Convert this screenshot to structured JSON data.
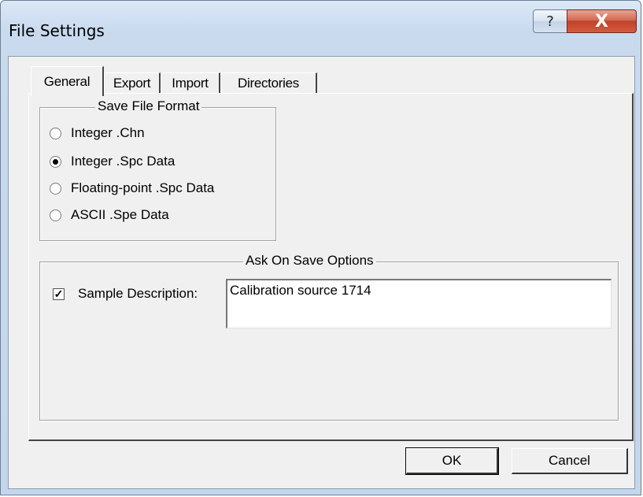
{
  "window": {
    "title": "File Settings",
    "help_label": "?",
    "close_label": "X"
  },
  "tabs": [
    {
      "label": "General",
      "active": true
    },
    {
      "label": "Export",
      "active": false
    },
    {
      "label": "Import",
      "active": false
    },
    {
      "label": "Directories",
      "active": false
    }
  ],
  "save_format": {
    "title": "Save File Format",
    "options": [
      {
        "label": "Integer .Chn",
        "selected": false
      },
      {
        "label": "Integer .Spc Data",
        "selected": true
      },
      {
        "label": "Floating-point .Spc Data",
        "selected": false
      },
      {
        "label": "ASCII .Spe Data",
        "selected": false
      }
    ]
  },
  "ask_on_save": {
    "title": "Ask On Save Options",
    "sample_description_label": "Sample Description:",
    "sample_description_checked": true,
    "sample_description_value": "Calibration source 1714"
  },
  "buttons": {
    "ok_label": "OK",
    "cancel_label": "Cancel"
  }
}
